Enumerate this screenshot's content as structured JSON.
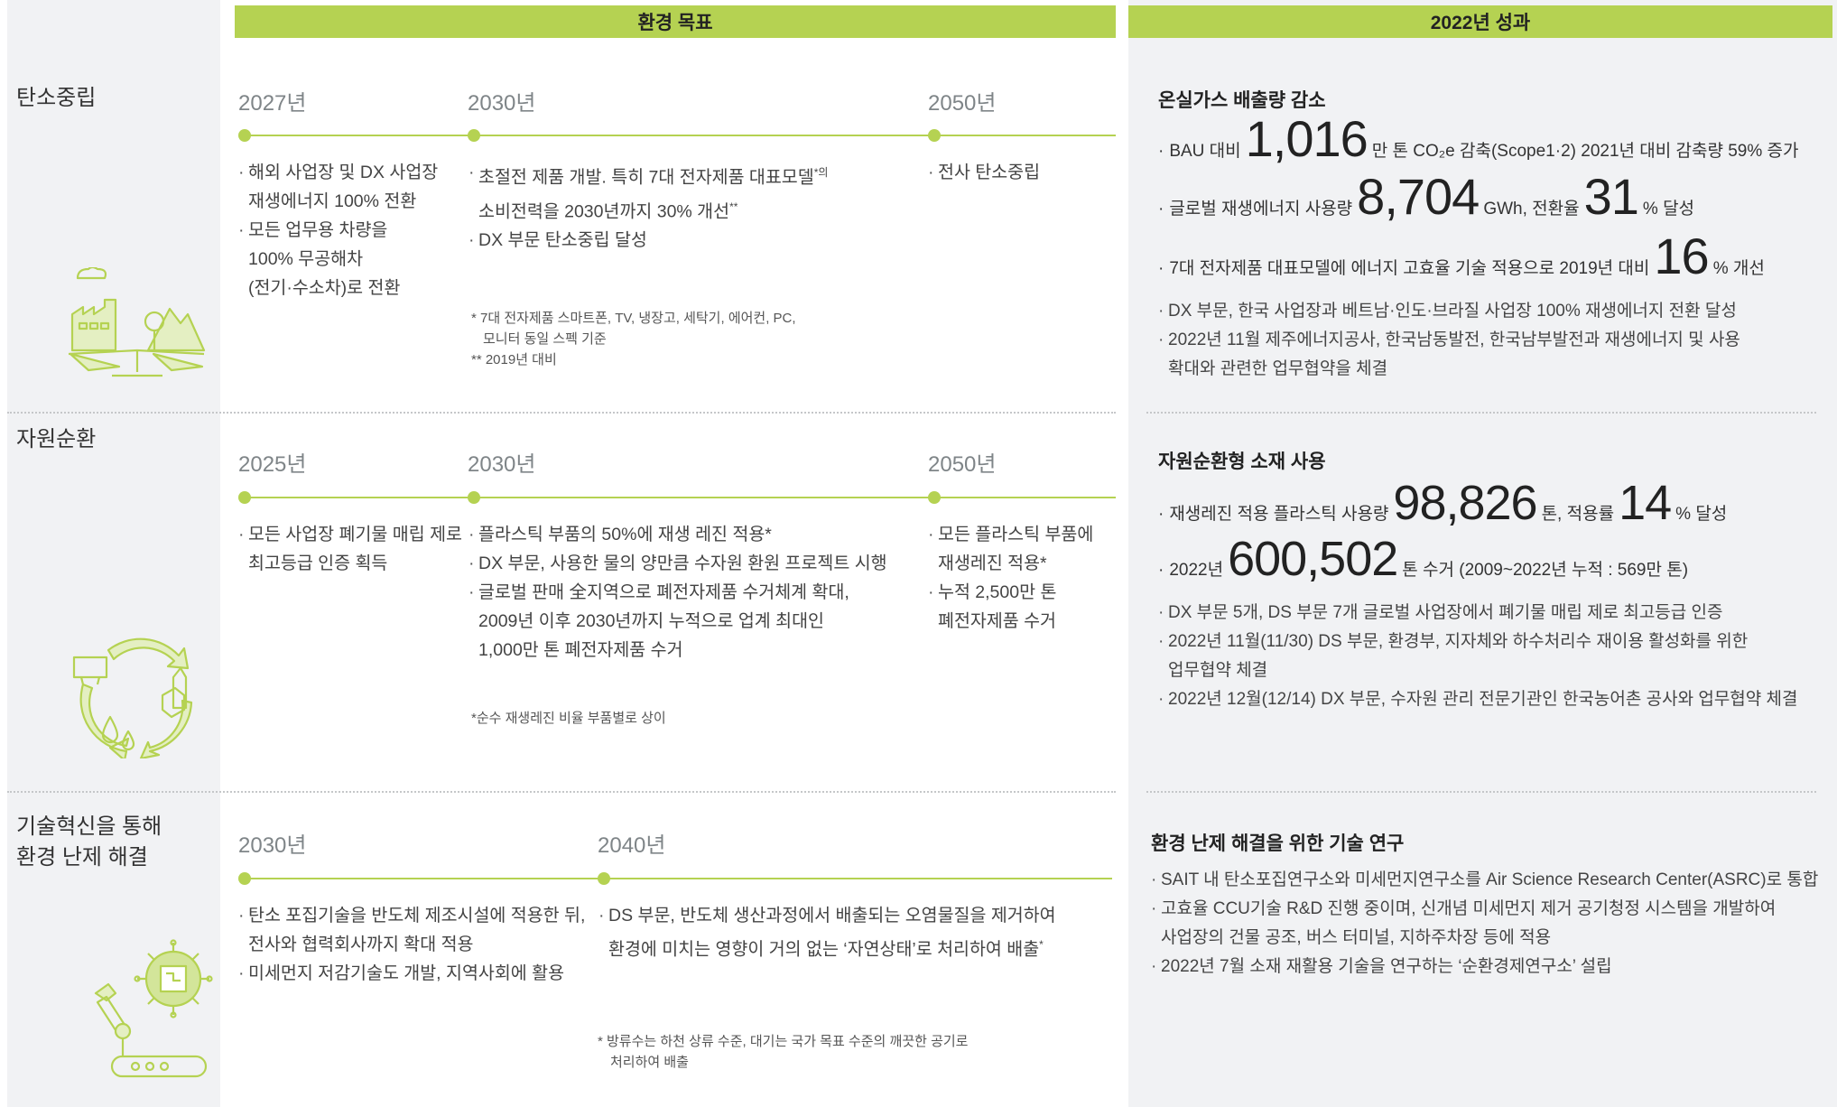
{
  "headers": {
    "goals": "환경 목표",
    "results": "2022년 성과"
  },
  "sections": [
    {
      "title": "탄소중립",
      "years": [
        "2027년",
        "2030년",
        "2050년"
      ],
      "col1": [
        "해외 사업장 및 DX 사업장",
        "재생에너지 100% 전환",
        "모든 업무용 차량을",
        "100% 무공해차",
        "(전기·수소차)로 전환"
      ],
      "col2": [
        "초절전 제품 개발. 특히 7대 전자제품 대표모델",
        "소비전력을 2030년까지 30% 개선",
        "DX 부문 탄소중립 달성"
      ],
      "col2_sup1": "*의",
      "col2_sup2": "**",
      "col3": [
        "전사 탄소중립"
      ],
      "notes": [
        "* 7대 전자제품 스마트폰, TV, 냉장고, 세탁기, 에어컨, PC,",
        "모니터 동일 스펙 기준",
        "** 2019년 대비"
      ],
      "icon": "eco-factory-scale-icon"
    },
    {
      "title": "자원순환",
      "years": [
        "2025년",
        "2030년",
        "2050년"
      ],
      "col1": [
        "모든 사업장 폐기물 매립 제로",
        "최고등급 인증 획득"
      ],
      "col2": [
        "플라스틱 부품의 50%에 재생 레진 적용*",
        "DX 부문, 사용한 물의 양만큼 수자원 환원 프로젝트 시행",
        "글로벌 판매 全지역으로 폐전자제품 수거체계 확대,",
        "2009년 이후 2030년까지 누적으로 업계 최대인",
        "1,000만 톤 폐전자제품 수거"
      ],
      "col3": [
        "모든 플라스틱 부품에",
        "재생레진 적용*",
        "누적 2,500만 톤",
        "폐전자제품 수거"
      ],
      "notes": [
        "*순수 재생레진 비율 부품별로 상이"
      ],
      "icon": "recycle-cycle-icon"
    },
    {
      "title_lines": [
        "기술혁신을 통해",
        "환경 난제 해결"
      ],
      "years": [
        "2030년",
        "2040년"
      ],
      "col1": [
        "탄소 포집기술을 반도체 제조시설에 적용한 뒤,",
        "전사와 협력회사까지 확대 적용",
        "미세먼지 저감기술도 개발, 지역사회에 활용"
      ],
      "col2": [
        "DS 부문, 반도체 생산과정에서 배출되는 오염물질을 제거하여",
        "환경에 미치는 영향이 거의 없는 ‘자연상태’로 처리하여 배출"
      ],
      "col2_sup": "*",
      "notes": [
        "* 방류수는 하천 상류 수준, 대기는 국가 목표 수준의 깨끗한 공기로",
        "처리하여 배출"
      ],
      "icon": "robot-arm-chip-icon"
    }
  ],
  "results": {
    "carbon": {
      "title": "온실가스 배출량 감소",
      "l1_pre": "BAU 대비",
      "l1_big": "1,016",
      "l1_post": "만 톤 CO₂e 감축(Scope1·2) 2021년 대비 감축량 59% 증가",
      "l2_pre": "글로벌 재생에너지 사용량",
      "l2_big": "8,704",
      "l2_mid": "GWh, 전환율",
      "l2_big2": "31",
      "l2_post": "% 달성",
      "l3_pre": "7대 전자제품 대표모델에 에너지 고효율 기술 적용으로 2019년 대비",
      "l3_big": "16",
      "l3_post": "% 개선",
      "bullets": [
        "DX 부문, 한국 사업장과 베트남·인도·브라질 사업장 100% 재생에너지 전환 달성",
        "2022년 11월 제주에너지공사, 한국남동발전, 한국남부발전과 재생에너지 및 사용",
        "확대와 관련한 업무협약을 체결"
      ]
    },
    "resource": {
      "title": "자원순환형 소재 사용",
      "l1_pre": "재생레진 적용 플라스틱 사용량",
      "l1_big": "98,826",
      "l1_mid": "톤, 적용률",
      "l1_big2": "14",
      "l1_post": "% 달성",
      "l2_pre": "2022년",
      "l2_big": "600,502",
      "l2_post": "톤 수거 (2009~2022년 누적 : 569만 톤)",
      "bullets": [
        "DX 부문 5개, DS 부문 7개 글로벌 사업장에서 폐기물 매립 제로 최고등급 인증",
        "2022년 11월(11/30) DS 부문, 환경부, 지자체와 하수처리수 재이용 활성화를 위한",
        "업무협약 체결",
        "2022년 12월(12/14) DX 부문, 수자원 관리 전문기관인 한국농어촌 공사와 업무협약 체결"
      ]
    },
    "tech": {
      "title": "환경 난제 해결을 위한 기술 연구",
      "bullets": [
        "SAIT 내 탄소포집연구소와 미세먼지연구소를 Air Science Research Center(ASRC)로 통합",
        "고효율 CCU기술 R&D 진행 중이며, 신개념 미세먼지 제거 공기청정 시스템을 개발하여",
        "사업장의 건물 공조, 버스 터미널, 지하주차장 등에 적용",
        "2022년 7월 소재 재활용 기술을 연구하는 ‘순환경제연구소’ 설립"
      ]
    }
  },
  "colors": {
    "accent": "#b5d252",
    "panel": "#f1f2f4",
    "icon": "#b5d252"
  }
}
